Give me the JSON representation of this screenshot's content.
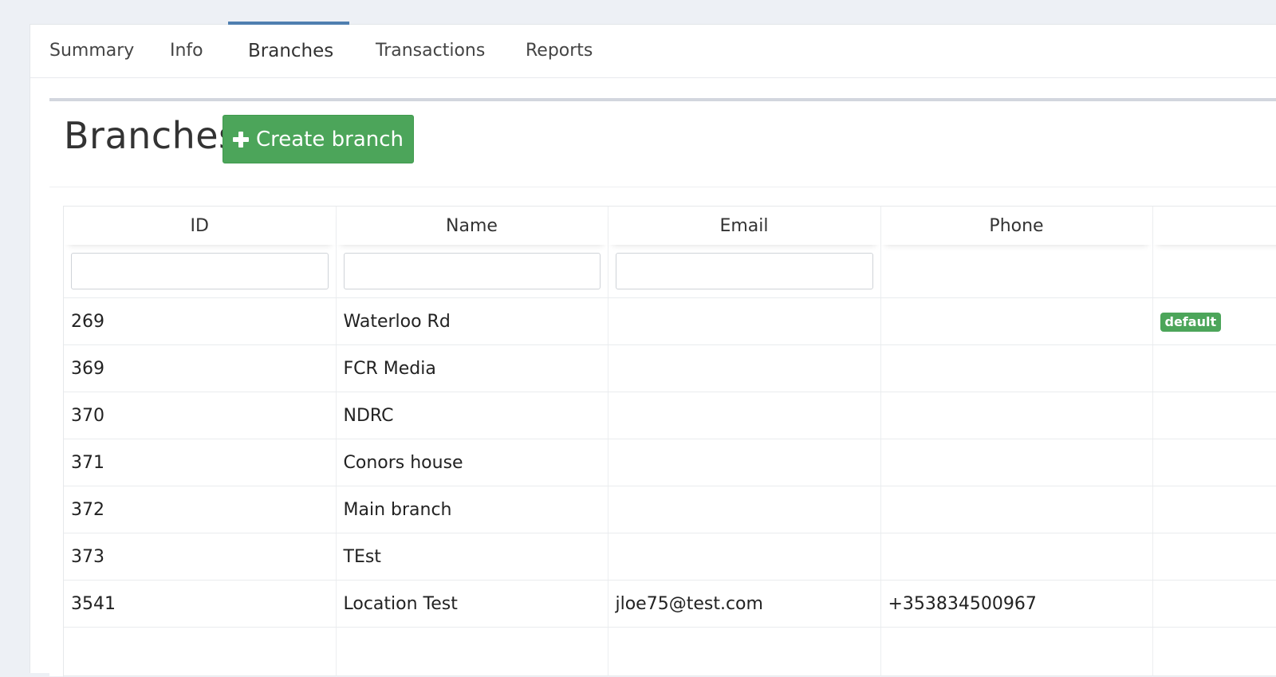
{
  "tabs": [
    {
      "label": "Summary"
    },
    {
      "label": "Info"
    },
    {
      "label": "Branches"
    },
    {
      "label": "Transactions"
    },
    {
      "label": "Reports"
    }
  ],
  "box": {
    "title": "Branches",
    "create_label": "Create branch"
  },
  "table": {
    "columns": [
      "ID",
      "Name",
      "Email",
      "Phone",
      ""
    ],
    "filters": {
      "id": "",
      "name": "",
      "email": ""
    },
    "rows": [
      {
        "id": "269",
        "name": "Waterloo Rd",
        "email": "",
        "phone": "",
        "badge": "default"
      },
      {
        "id": "369",
        "name": "FCR Media",
        "email": "",
        "phone": "",
        "badge": ""
      },
      {
        "id": "370",
        "name": "NDRC",
        "email": "",
        "phone": "",
        "badge": ""
      },
      {
        "id": "371",
        "name": "Conors house",
        "email": "",
        "phone": "",
        "badge": ""
      },
      {
        "id": "372",
        "name": "Main branch",
        "email": "",
        "phone": "",
        "badge": ""
      },
      {
        "id": "373",
        "name": "TEst",
        "email": "",
        "phone": "",
        "badge": ""
      },
      {
        "id": "3541",
        "name": "Location Test",
        "email": "jloe75@test.com",
        "phone": "+353834500967",
        "badge": ""
      }
    ]
  },
  "colors": {
    "accent": "#4f7fb0",
    "success": "#4ca55a",
    "background": "#edf0f5"
  }
}
